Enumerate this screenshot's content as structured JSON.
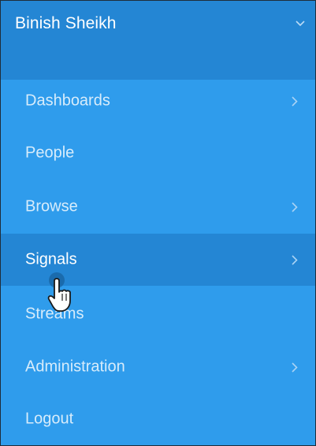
{
  "user": {
    "name": "Binish Sheikh"
  },
  "menu": {
    "items": [
      {
        "label": "Dashboards",
        "has_submenu": true,
        "active": false
      },
      {
        "label": "People",
        "has_submenu": false,
        "active": false
      },
      {
        "label": "Browse",
        "has_submenu": true,
        "active": false
      },
      {
        "label": "Signals",
        "has_submenu": true,
        "active": true
      },
      {
        "label": "Streams",
        "has_submenu": false,
        "active": false
      },
      {
        "label": "Administration",
        "has_submenu": true,
        "active": false
      },
      {
        "label": "Logout",
        "has_submenu": false,
        "active": false
      }
    ]
  },
  "icons": {
    "header_toggle": "chevron-down-icon",
    "submenu_indicator": "chevron-right-icon",
    "pointer": "hand-pointer-cursor-icon"
  },
  "colors": {
    "menu_background": "#2f9cec",
    "header_background": "#2486d4",
    "active_item_background": "#2486d4",
    "item_text": "#d7ecfb",
    "active_text": "#ffffff"
  }
}
